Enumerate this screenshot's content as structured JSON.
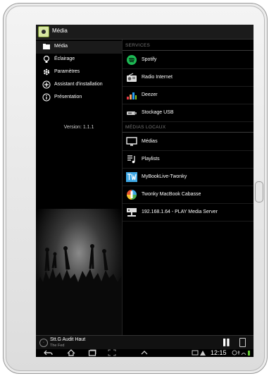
{
  "app": {
    "title": "Média"
  },
  "drawer": {
    "items": [
      {
        "label": "Média",
        "icon": "media-folder-icon"
      },
      {
        "label": "Éclairage",
        "icon": "lightbulb-icon"
      },
      {
        "label": "Paramètres",
        "icon": "gear-icon"
      },
      {
        "label": "Assistant d'installation",
        "icon": "plus-circle-icon"
      },
      {
        "label": "Présentation",
        "icon": "info-icon"
      }
    ],
    "version": "Version: 1.1.1"
  },
  "content": {
    "services_header": "SERVICES",
    "services": [
      {
        "label": "Spotify",
        "icon": "spotify-icon"
      },
      {
        "label": "Radio Internet",
        "icon": "radio-icon"
      },
      {
        "label": "Deezer",
        "icon": "deezer-icon"
      },
      {
        "label": "Stockage USB",
        "icon": "usb-storage-icon"
      }
    ],
    "local_header": "MÉDIAS LOCAUX",
    "local": [
      {
        "label": "Médias",
        "icon": "monitor-icon"
      },
      {
        "label": "Playlists",
        "icon": "playlist-icon"
      },
      {
        "label": "MyBookLive-Twonky",
        "icon": "twonky-icon"
      },
      {
        "label": "Twonky MacBook Cabasse",
        "icon": "twonky-color-icon"
      },
      {
        "label": "192.168.1.64 - PLAY    Media Server",
        "icon": "network-server-icon"
      }
    ]
  },
  "player": {
    "title": "Stt.G  Audit Haut",
    "subtitle": "The Fed"
  },
  "system": {
    "time": "12:15"
  },
  "colors": {
    "spotify": "#1db954",
    "twonky_blue": "#3fa9e6",
    "background": "#000000"
  }
}
